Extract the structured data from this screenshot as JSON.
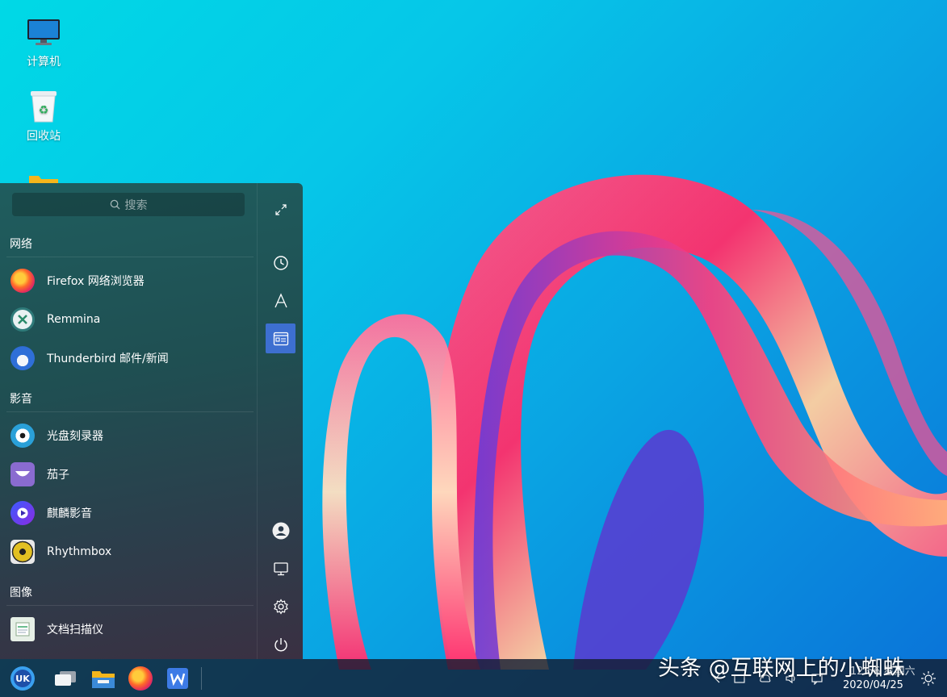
{
  "desktop": {
    "icons": [
      {
        "label": "计算机"
      },
      {
        "label": "回收站"
      }
    ]
  },
  "start_menu": {
    "search": {
      "placeholder": "搜索"
    },
    "sections": [
      {
        "title": "网络",
        "apps": [
          "Firefox 网络浏览器",
          "Remmina",
          "Thunderbird 邮件/新闻"
        ]
      },
      {
        "title": "影音",
        "apps": [
          "光盘刻录器",
          "茄子",
          "麒麟影音",
          "Rhythmbox"
        ]
      },
      {
        "title": "图像",
        "apps": [
          "文档扫描仪"
        ]
      }
    ]
  },
  "taskbar": {
    "clock_time": "12:56 星期六",
    "clock_date": "2020/04/25"
  },
  "watermark": "头条 @互联网上的小蜘蛛",
  "colors": {
    "accent": "#3d6fd0",
    "menu_bg": "#1f4f52",
    "taskbar_bg": "#141e32"
  }
}
